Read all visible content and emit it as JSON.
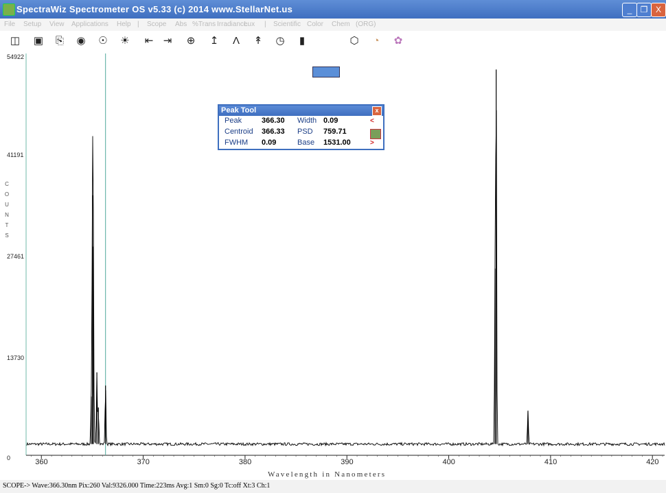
{
  "window": {
    "title": "SpectraWiz  Spectrometer OS v5.33 (c) 2014   www.StellarNet.us",
    "minimize": "_",
    "restore": "❐",
    "close": "X"
  },
  "menu": [
    "File",
    "Setup",
    "View",
    "Applications",
    "Help",
    "|",
    "Scope",
    "Abs",
    "%Trans",
    "Irradiance",
    "Lux",
    "|",
    "Scientific",
    "Color",
    "Chem",
    "(ORG)"
  ],
  "toolbar": {
    "icons": [
      "open-icon",
      "save-icon",
      "print-icon",
      "camera-icon",
      "bulb-dark-icon",
      "bulb-light-icon",
      "scroll-left-icon",
      "scroll-right-icon",
      "zoom-icon",
      "autoscale-icon",
      "peaks-icon",
      "baseline-icon",
      "timer-icon",
      "bar-icon",
      "detector-icon",
      "color-wheel-icon",
      "palette-icon"
    ]
  },
  "peak_tool": {
    "title": "Peak Tool",
    "close": "x",
    "rows": [
      {
        "label1": "Peak",
        "value1": "366.30",
        "label2": "Width",
        "value2": "0.09",
        "arrow": "<"
      },
      {
        "label1": "Centroid",
        "value1": "366.33",
        "label2": "PSD",
        "value2": "759.71",
        "arrow": ""
      },
      {
        "label1": "FWHM",
        "value1": "0.09",
        "label2": "Base",
        "value2": "1531.00",
        "arrow": ">"
      }
    ],
    "swatch_color": "#7a9e5a"
  },
  "chart_data": {
    "type": "line",
    "title": "",
    "xlabel": "Wavelength in Nanometers",
    "ylabel": "COUNTS",
    "xlim": [
      358.5,
      421.2
    ],
    "ylim": [
      0,
      54922
    ],
    "x_ticks": [
      360,
      370,
      380,
      390,
      400,
      410,
      420
    ],
    "y_ticks": [
      "54922",
      "41191",
      "27461",
      "13730",
      "0"
    ],
    "y_tick_values": [
      54922,
      41191,
      27461,
      13730,
      0
    ],
    "cursor_x": 366.3,
    "baseline": 1531,
    "peaks": [
      {
        "x": 364.9,
        "y": 6500
      },
      {
        "x": 365.02,
        "y": 34000
      },
      {
        "x": 365.1,
        "y": 27000
      },
      {
        "x": 365.45,
        "y": 9800
      },
      {
        "x": 365.6,
        "y": 5000
      },
      {
        "x": 366.3,
        "y": 8000
      },
      {
        "x": 404.55,
        "y": 24000
      },
      {
        "x": 404.66,
        "y": 51200
      },
      {
        "x": 407.78,
        "y": 4500
      }
    ],
    "line_color": "#000000",
    "cursor_color": "#4fa79a"
  },
  "status": {
    "text": "SCOPE->  Wave:366.30nm  Pix:260  Val:9326.000  Time:223ms  Avg:1  Sm:0  Sg:0  Tc:off  Xt:3  Ch:1"
  }
}
